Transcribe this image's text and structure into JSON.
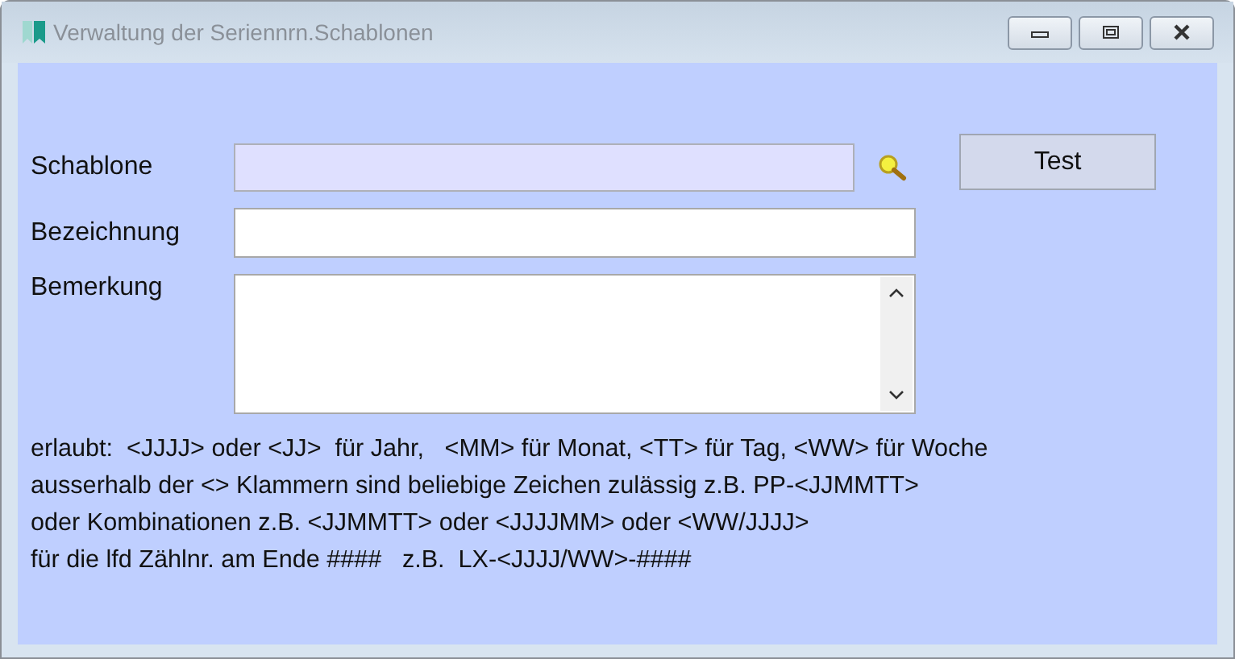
{
  "window": {
    "title": "Verwaltung der Seriennrn.Schablonen"
  },
  "fields": [
    {
      "label": "Schablone",
      "kind": "lookup",
      "disabled": true
    },
    {
      "label": "Bezeichnung",
      "kind": "text",
      "disabled": false
    },
    {
      "label": "Bemerkung",
      "kind": "memo",
      "disabled": false
    }
  ],
  "test_button": {
    "label": "Test"
  },
  "help_lines": [
    "erlaubt:  <JJJJ> oder <JJ>  für Jahr,   <MM> für Monat, <TT> für Tag, <WW> für Woche",
    "ausserhalb der <> Klammern sind beliebige Zeichen zulässig z.B. PP-<JJMMTT>",
    "oder Kombinationen z.B. <JJMMTT> oder <JJJJMM> oder <WW/JJJJ>",
    "für die lfd Zählnr. am Ende ####   z.B.  LX-<JJJJ/WW>-####"
  ]
}
